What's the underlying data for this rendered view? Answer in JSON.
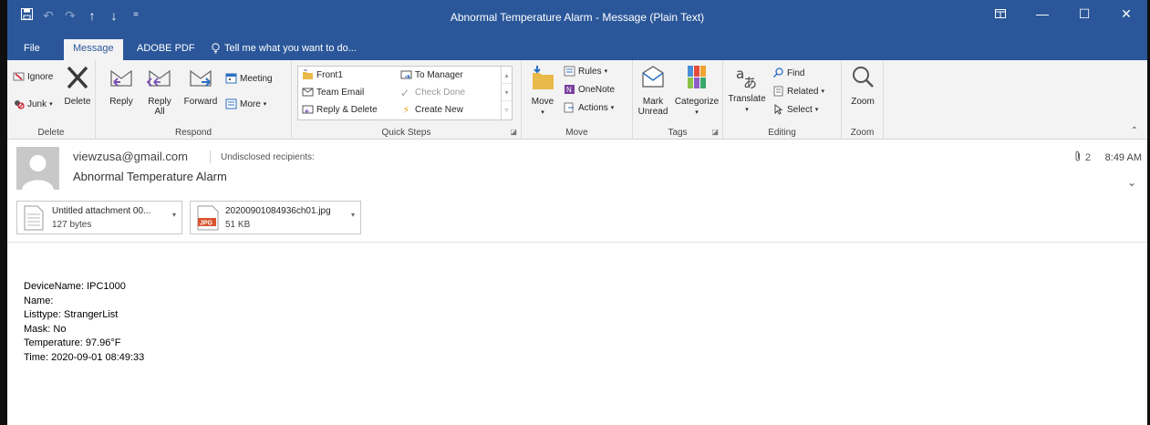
{
  "window": {
    "title": "Abnormal Temperature Alarm - Message (Plain Text)",
    "controls": [
      "ribbon-display-icon",
      "minimize-icon",
      "maximize-icon",
      "close-icon"
    ]
  },
  "qat": {
    "save_icon": "save-icon",
    "undo_icon": "undo-icon",
    "redo_icon": "redo-icon",
    "up_icon": "up-arrow-icon",
    "down_icon": "down-arrow-icon",
    "customize_icon": "customize-qat-icon"
  },
  "tabs": {
    "file": "File",
    "message": "Message",
    "adobe_pdf": "ADOBE PDF",
    "tell_me": "Tell me what you want to do..."
  },
  "ribbon": {
    "delete_group": {
      "label": "Delete",
      "ignore": "Ignore",
      "junk": "Junk",
      "delete": "Delete"
    },
    "respond_group": {
      "label": "Respond",
      "reply": "Reply",
      "reply_all_line1": "Reply",
      "reply_all_line2": "All",
      "forward": "Forward",
      "meeting": "Meeting",
      "more": "More"
    },
    "quick_steps_group": {
      "label": "Quick Steps",
      "items": [
        "Front1",
        "Team Email",
        "Reply & Delete",
        "To Manager",
        "Check Done",
        "Create New"
      ]
    },
    "move_group": {
      "label": "Move",
      "move": "Move",
      "rules": "Rules",
      "onenote": "OneNote",
      "actions": "Actions"
    },
    "tags_group": {
      "label": "Tags",
      "mark_unread_line1": "Mark",
      "mark_unread_line2": "Unread",
      "categorize": "Categorize"
    },
    "editing_group": {
      "label": "Editing",
      "translate": "Translate",
      "find": "Find",
      "related": "Related",
      "select": "Select"
    },
    "zoom_group": {
      "label": "Zoom",
      "zoom": "Zoom"
    }
  },
  "message": {
    "from": "viewzusa@gmail.com",
    "to": "Undisclosed recipients:",
    "subject": "Abnormal Temperature Alarm",
    "attachment_count": "2",
    "time": "8:49 AM",
    "attachments": [
      {
        "name": "Untitled attachment 00...",
        "size": "127 bytes",
        "icon": "text-file-icon"
      },
      {
        "name": "20200901084936ch01.jpg",
        "size": "51 KB",
        "icon": "jpg-file-icon"
      }
    ]
  },
  "body": {
    "lines": [
      "DeviceName: IPC1000",
      "Name:",
      "Listtype: StrangerList",
      "Mask: No",
      "Temperature: 97.96°F",
      "Time: 2020-09-01 08:49:33"
    ]
  },
  "colors": {
    "titlebar": "#2b579a",
    "ribbon_bg": "#f3f3f3",
    "accent_purple": "#7a4fb5",
    "accent_blue": "#2b6fc2"
  }
}
